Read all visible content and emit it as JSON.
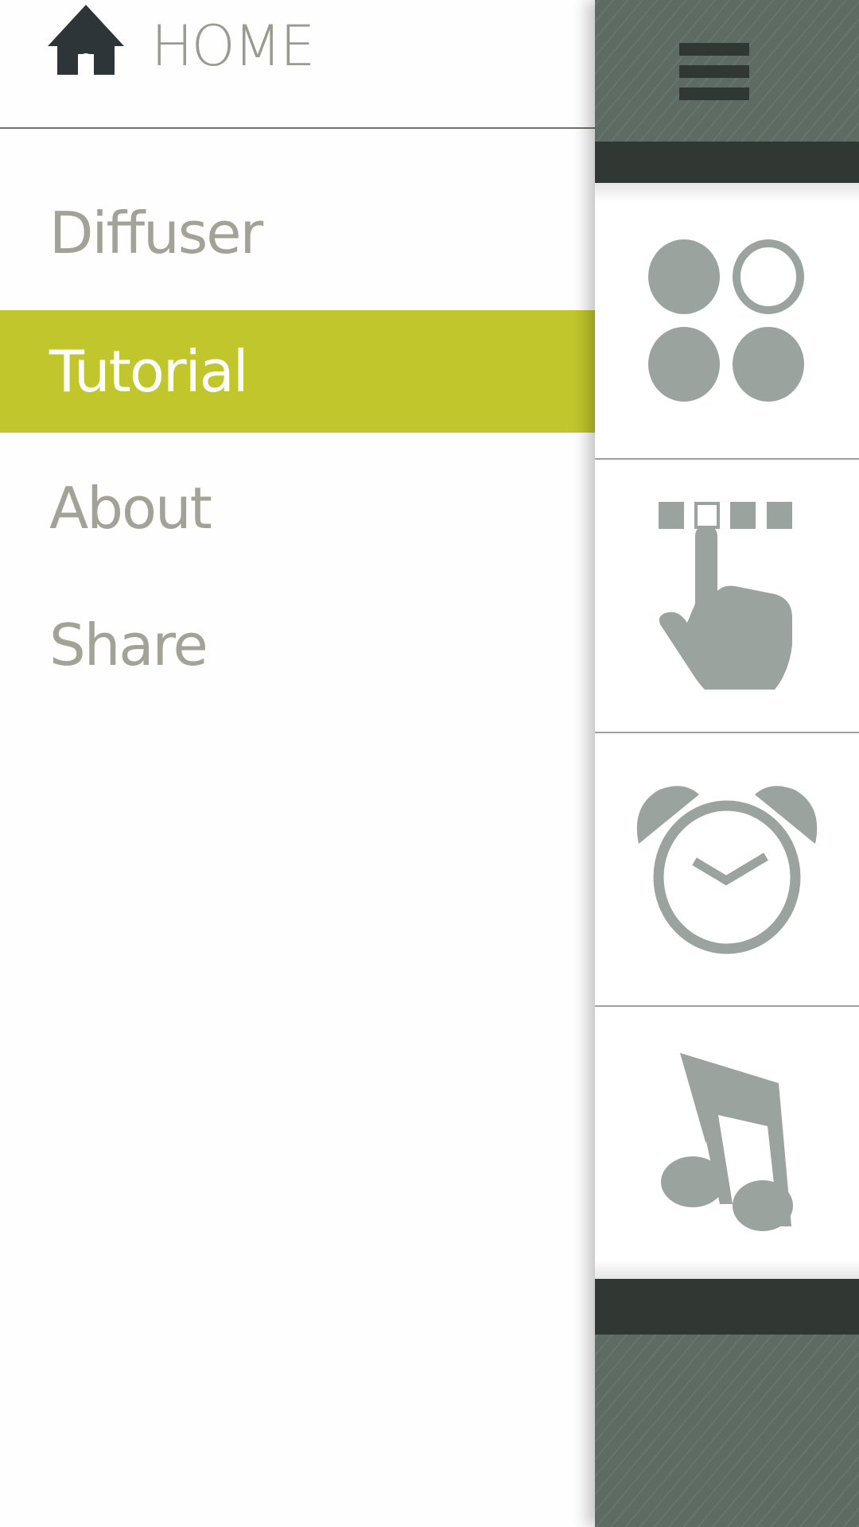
{
  "drawer": {
    "home": {
      "label": "HOME",
      "icon": "home-icon"
    },
    "items": [
      {
        "label": "Diffuser",
        "active": false
      },
      {
        "label": "Tutorial",
        "active": true
      },
      {
        "label": "About",
        "active": false
      },
      {
        "label": "Share",
        "active": false
      }
    ]
  },
  "rail": {
    "menu_icon": "hamburger-menu-icon",
    "icons": [
      "four-dots-icon",
      "tap-gesture-icon",
      "alarm-clock-icon",
      "music-note-icon"
    ]
  },
  "colors": {
    "accent": "#c0c62b",
    "text_muted": "#a3a296",
    "icon_gray": "#9aa39e",
    "panel_dark": "#313833",
    "panel_hatch": "#5d6b62",
    "home_icon": "#2e3538"
  }
}
